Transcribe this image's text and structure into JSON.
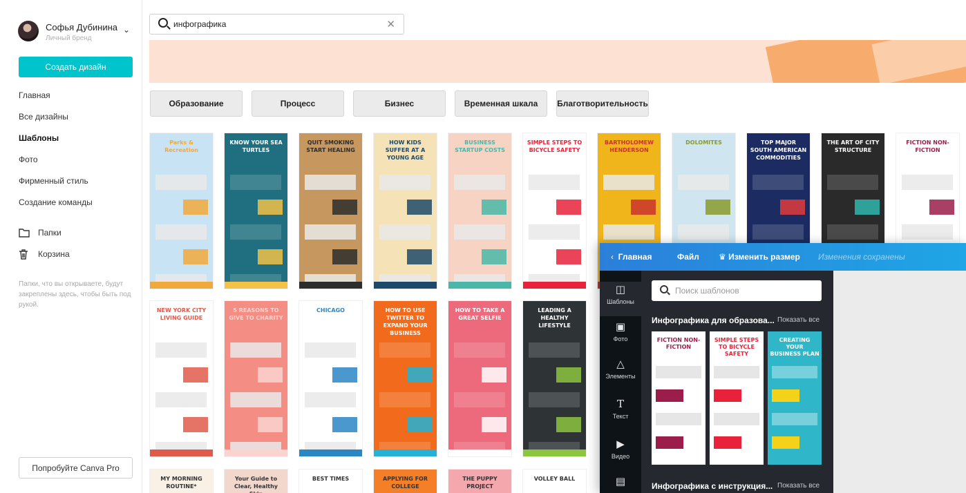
{
  "user": {
    "name": "Софья Дубинина",
    "subtitle": "Личный бренд"
  },
  "sidebar": {
    "create_label": "Создать дизайн",
    "nav": [
      "Главная",
      "Все дизайны",
      "Шаблоны",
      "Фото",
      "Фирменный стиль",
      "Создание команды"
    ],
    "folders": [
      {
        "label": "Папки",
        "icon": "folder-icon"
      },
      {
        "label": "Корзина",
        "icon": "trash-icon"
      }
    ],
    "note": "Папки, что вы открываете, будут закреплены здесь, чтобы быть под рукой.",
    "pro_label": "Попробуйте Canva Pro"
  },
  "search": {
    "value": "инфографика"
  },
  "chips": [
    "Образование",
    "Процесс",
    "Бизнес",
    "Временная шкала",
    "Благотворительность"
  ],
  "templates_row1": [
    {
      "title": "Parks & Recreation",
      "bg": "#c8e4f4",
      "accent": "#f2a93b"
    },
    {
      "title": "KNOW YOUR SEA TURTLES",
      "bg": "#1f6f80",
      "accent": "#f3c246"
    },
    {
      "title": "QUIT SMOKING START HEALING",
      "bg": "#c6975e",
      "accent": "#2d2d2d"
    },
    {
      "title": "HOW KIDS SUFFER AT A YOUNG AGE",
      "bg": "#f6e2b7",
      "accent": "#1d4a6b"
    },
    {
      "title": "BUSINESS STARTUP COSTS",
      "bg": "#f7d3c4",
      "accent": "#4ab7a8"
    },
    {
      "title": "SIMPLE STEPS TO BICYCLE SAFETY",
      "bg": "#ffffff",
      "accent": "#e8223a"
    },
    {
      "title": "BARTHOLOMEW HENDERSON",
      "bg": "#f1b51c",
      "accent": "#c9322a"
    },
    {
      "title": "DOLOMITES",
      "bg": "#cfe6f0",
      "accent": "#8a9a2d"
    },
    {
      "title": "TOP MAJOR SOUTH AMERICAN COMMODITIES",
      "bg": "#1c2c63",
      "accent": "#e23b3b"
    },
    {
      "title": "THE ART OF CITY STRUCTURE",
      "bg": "#2a2a2a",
      "accent": "#2fb7ad"
    },
    {
      "title": "FICTION NON-FICTION",
      "bg": "#ffffff",
      "accent": "#9b1d4a"
    }
  ],
  "templates_row2": [
    {
      "title": "NEW YORK CITY LIVING GUIDE",
      "bg": "#ffffff",
      "accent": "#e05a4b"
    },
    {
      "title": "5 REASONS TO GIVE TO CHARITY",
      "bg": "#f48d84",
      "accent": "#fbd3cf"
    },
    {
      "title": "CHICAGO",
      "bg": "#ffffff",
      "accent": "#2b86c6"
    },
    {
      "title": "HOW TO USE TWITTER TO EXPAND YOUR BUSINESS",
      "bg": "#f26a1c",
      "accent": "#25b2d6"
    },
    {
      "title": "HOW TO TAKE A GREAT SELFIE",
      "bg": "#ed6a7c",
      "accent": "#ffffff"
    },
    {
      "title": "LEADING A HEALTHY LIFESTYLE",
      "bg": "#2e3436",
      "accent": "#8cc63f"
    }
  ],
  "templates_row3": [
    {
      "title": "MY MORNING ROUTINE*",
      "bg": "#f9f0e6"
    },
    {
      "title": "Your Guide to Clear, Healthy Skin",
      "bg": "#f2d7cc"
    },
    {
      "title": "BEST TIMES",
      "bg": "#ffffff"
    },
    {
      "title": "APPLYING FOR COLLEGE",
      "bg": "#f47f27"
    },
    {
      "title": "THE PUPPY PROJECT",
      "bg": "#f4a7ad"
    },
    {
      "title": "VOLLEY BALL",
      "bg": "#ffffff"
    }
  ],
  "editor": {
    "back_label": "Главная",
    "file_label": "Файл",
    "resize_label": "Изменить размер",
    "saved_label": "Изменения сохранены",
    "rail": [
      {
        "label": "Шаблоны",
        "icon": "templates-icon"
      },
      {
        "label": "Фото",
        "icon": "photo-icon"
      },
      {
        "label": "Элементы",
        "icon": "elements-icon"
      },
      {
        "label": "Текст",
        "icon": "text-icon"
      },
      {
        "label": "Видео",
        "icon": "video-icon"
      }
    ],
    "search_placeholder": "Поиск шаблонов",
    "section1_title": "Инфографика для образова...",
    "section1_all": "Показать все",
    "section2_title": "Инфографика с инструкция...",
    "section2_all": "Показать все",
    "thumbs": [
      {
        "title": "FICTION NON-FICTION",
        "bg": "#ffffff",
        "accent": "#9b1d4a"
      },
      {
        "title": "SIMPLE STEPS TO BICYCLE SAFETY",
        "bg": "#ffffff",
        "accent": "#e8223a"
      },
      {
        "title": "CREATING YOUR BUSINESS PLAN",
        "bg": "#2fb7c9",
        "accent": "#f4d21a"
      }
    ]
  }
}
